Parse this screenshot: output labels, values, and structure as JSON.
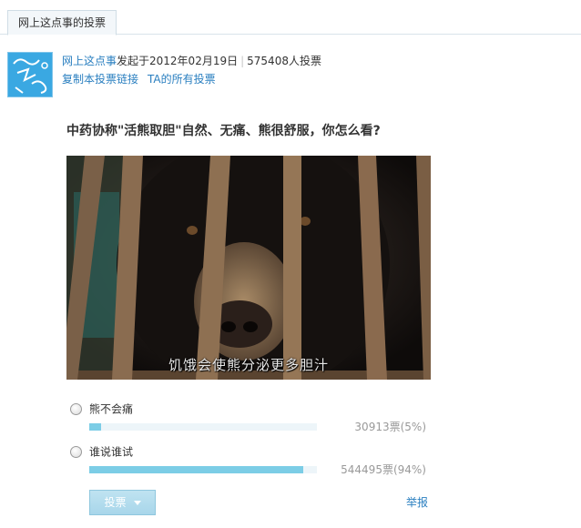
{
  "tab": {
    "label": "网上这点事的投票"
  },
  "avatar": {
    "text": "网上这点事"
  },
  "author": {
    "name": "网上这点事",
    "started_text": "发起于2012年02月19日",
    "separator": "|",
    "total_votes_text": "575408人投票"
  },
  "links": {
    "copy_link": "复制本投票链接",
    "all_votes": "TA的所有投票"
  },
  "question": "中药协称\"活熊取胆\"自然、无痛、熊很舒服，你怎么看?",
  "image": {
    "subtitle": "饥饿会使熊分泌更多胆汁"
  },
  "options": [
    {
      "label": "熊不会痛",
      "count_text": "30913票(5%)",
      "fraction": 0.05
    },
    {
      "label": "谁说谁试",
      "count_text": "544495票(94%)",
      "fraction": 0.94
    }
  ],
  "actions": {
    "vote_button": "投票",
    "report_link": "举报"
  },
  "colors": {
    "link": "#2a7fc0",
    "bar_fill": "#7ccde6",
    "bar_track": "#edf5f9",
    "avatar_bg": "#39a7e0",
    "button_bg": "#a8d6ea"
  },
  "icons": {
    "radio": "radio-button-unchecked",
    "caret": "caret-down-icon"
  }
}
